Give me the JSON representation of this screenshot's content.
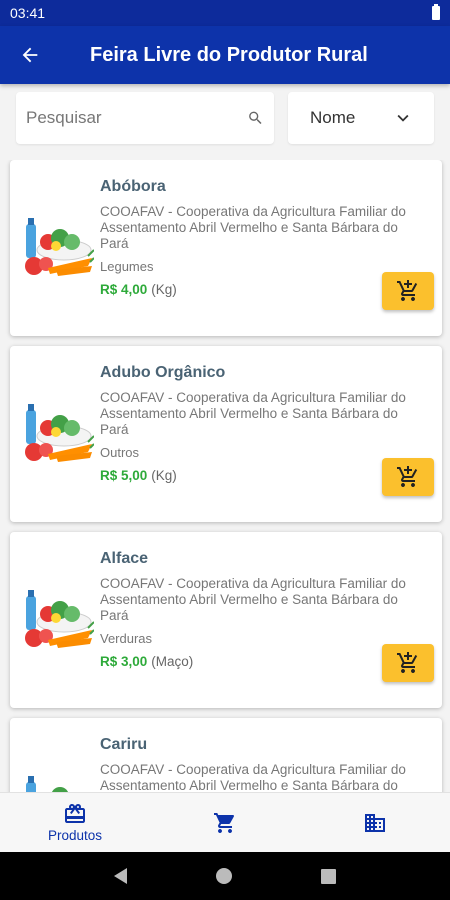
{
  "status_bar": {
    "time": "03:41"
  },
  "app_bar": {
    "title": "Feira Livre do Produtor Rural"
  },
  "search": {
    "placeholder": "Pesquisar"
  },
  "sort": {
    "selected": "Nome"
  },
  "colors": {
    "primary": "#0d33aa",
    "status_bar": "#0d2b9b",
    "price_green": "#2eaa3a",
    "cart_button": "#fbc02d"
  },
  "products": [
    {
      "name": "Abóbora",
      "producer": "COOAFAV - Cooperativa da Agricultura Familiar do Assentamento Abril Vermelho e Santa Bárbara do Pará",
      "category": "Legumes",
      "price": "R$ 4,00",
      "unit": "(Kg)"
    },
    {
      "name": "Adubo Orgânico",
      "producer": "COOAFAV - Cooperativa da Agricultura Familiar do Assentamento Abril Vermelho e Santa Bárbara do Pará",
      "category": "Outros",
      "price": "R$ 5,00",
      "unit": "(Kg)"
    },
    {
      "name": "Alface",
      "producer": "COOAFAV - Cooperativa da Agricultura Familiar do Assentamento Abril Vermelho e Santa Bárbara do Pará",
      "category": "Verduras",
      "price": "R$ 3,00",
      "unit": "(Maço)"
    },
    {
      "name": "Cariru",
      "producer": "COOAFAV - Cooperativa da Agricultura Familiar do Assentamento Abril Vermelho e Santa Bárbara do Pará",
      "category": "",
      "price": "",
      "unit": ""
    }
  ],
  "bottom_nav": {
    "items": [
      {
        "label": "Produtos",
        "icon": "gift-icon"
      },
      {
        "label": "",
        "icon": "cart-icon"
      },
      {
        "label": "",
        "icon": "store-icon"
      }
    ]
  }
}
